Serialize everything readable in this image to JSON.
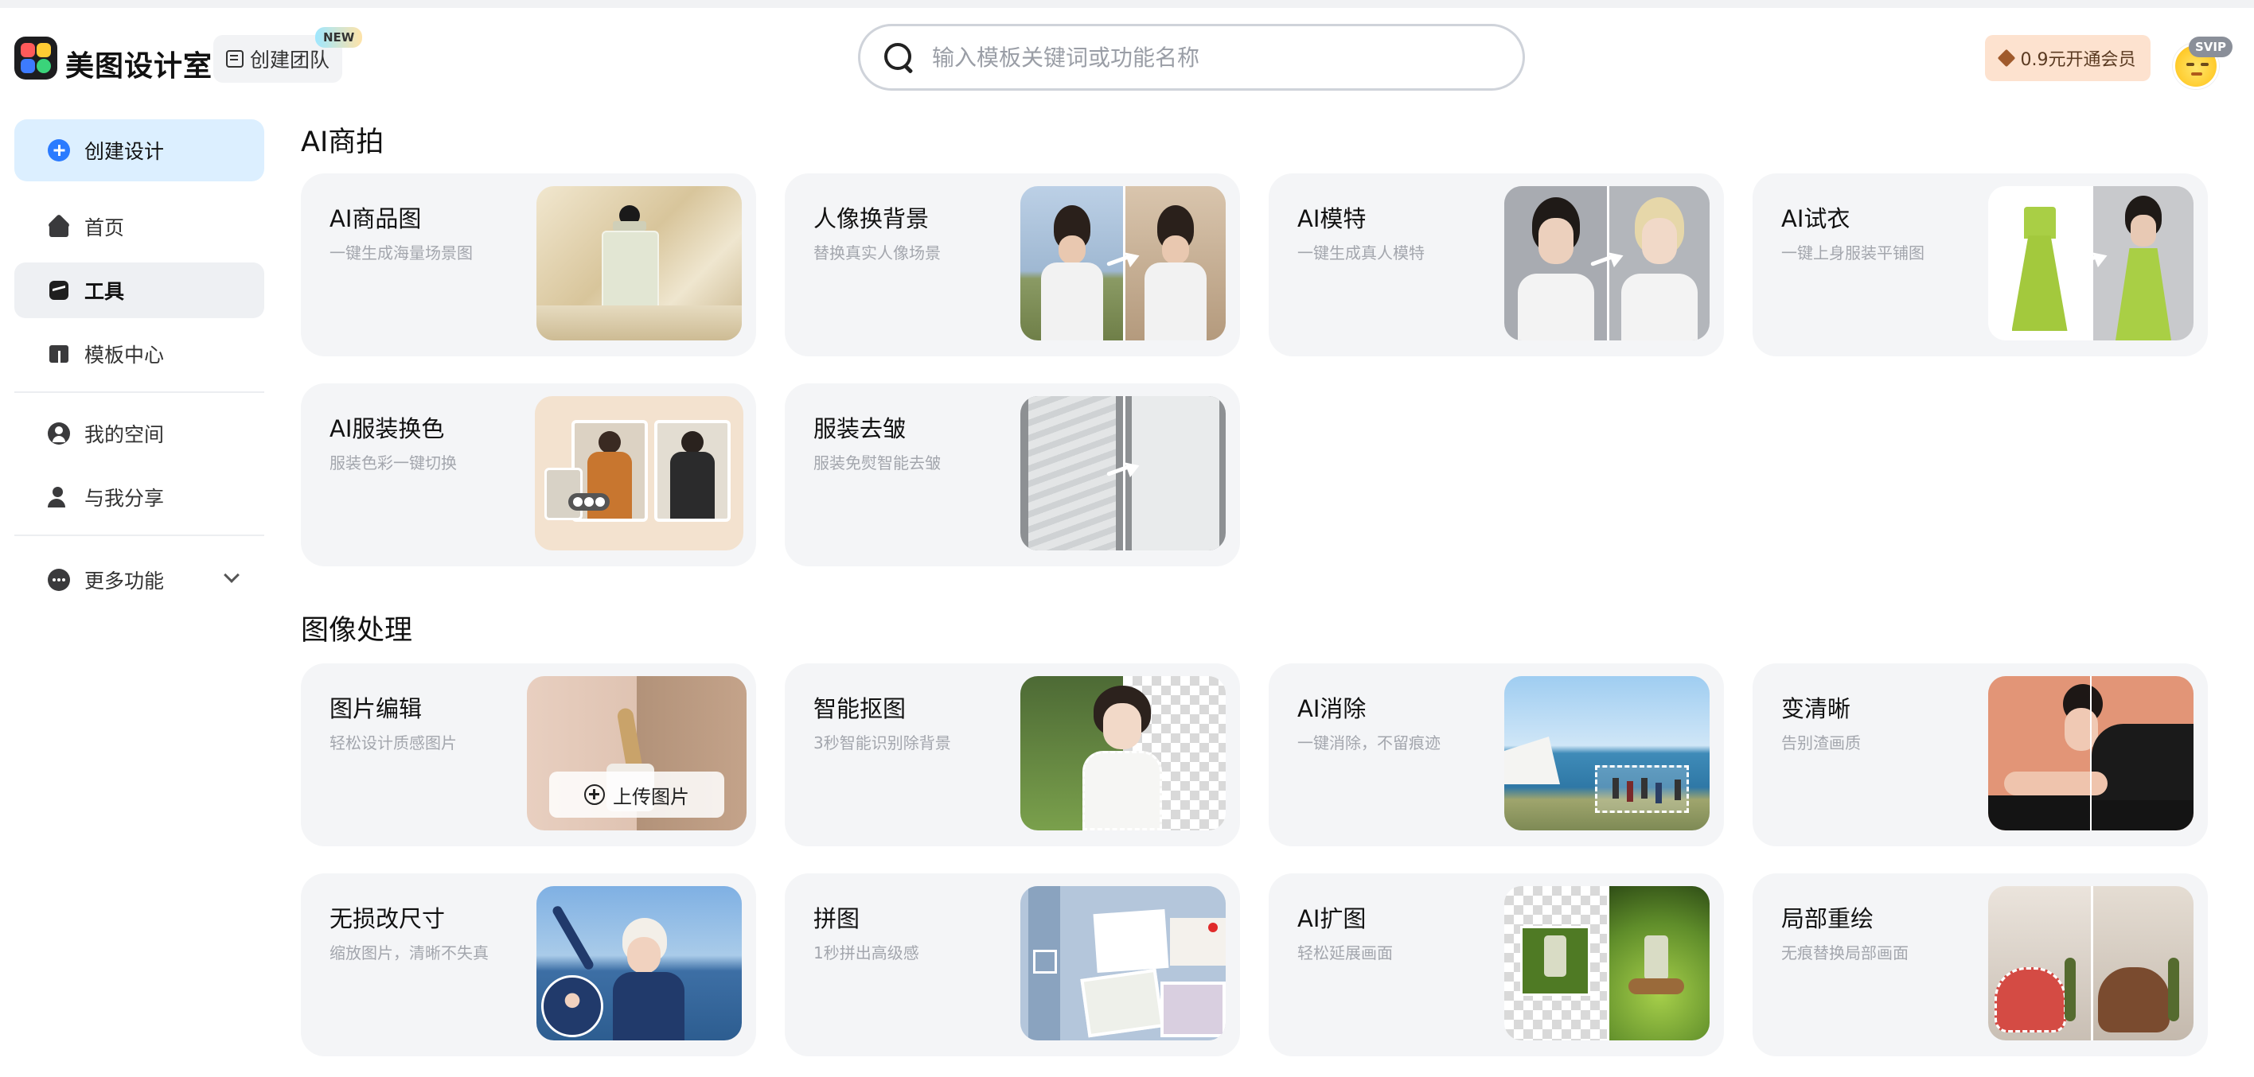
{
  "app": {
    "brand": "美图设计室",
    "team_button": "创建团队",
    "new_badge": "NEW",
    "search_placeholder": "输入模板关键词或功能名称",
    "vip_button": "0.9元开通会员",
    "svip_badge": "SVIP"
  },
  "sidebar": {
    "create": "创建设计",
    "items": [
      {
        "label": "首页",
        "icon": "home-icon"
      },
      {
        "label": "工具",
        "icon": "tools-icon",
        "active": true
      },
      {
        "label": "模板中心",
        "icon": "template-icon"
      },
      {
        "label": "我的空间",
        "icon": "user-icon"
      },
      {
        "label": "与我分享",
        "icon": "share-icon"
      },
      {
        "label": "更多功能",
        "icon": "more-icon"
      }
    ]
  },
  "sections": [
    {
      "title": "AI商拍",
      "cards": [
        {
          "title": "AI商品图",
          "desc": "一键生成海量场景图"
        },
        {
          "title": "人像换背景",
          "desc": "替换真实人像场景"
        },
        {
          "title": "AI模特",
          "desc": "一键生成真人模特"
        },
        {
          "title": "AI试衣",
          "desc": "一键上身服装平铺图"
        },
        {
          "title": "AI服装换色",
          "desc": "服装色彩一键切换"
        },
        {
          "title": "服装去皱",
          "desc": "服装免熨智能去皱"
        }
      ]
    },
    {
      "title": "图像处理",
      "cards": [
        {
          "title": "图片编辑",
          "desc": "轻松设计质感图片",
          "upload": "上传图片"
        },
        {
          "title": "智能抠图",
          "desc": "3秒智能识别除背景"
        },
        {
          "title": "AI消除",
          "desc": "一键消除，不留痕迹"
        },
        {
          "title": "变清晰",
          "desc": "告别渣画质"
        },
        {
          "title": "无损改尺寸",
          "desc": "缩放图片，清晰不失真"
        },
        {
          "title": "拼图",
          "desc": "1秒拼出高级感"
        },
        {
          "title": "AI扩图",
          "desc": "轻松延展画面"
        },
        {
          "title": "局部重绘",
          "desc": "无痕替换局部画面"
        }
      ]
    }
  ]
}
